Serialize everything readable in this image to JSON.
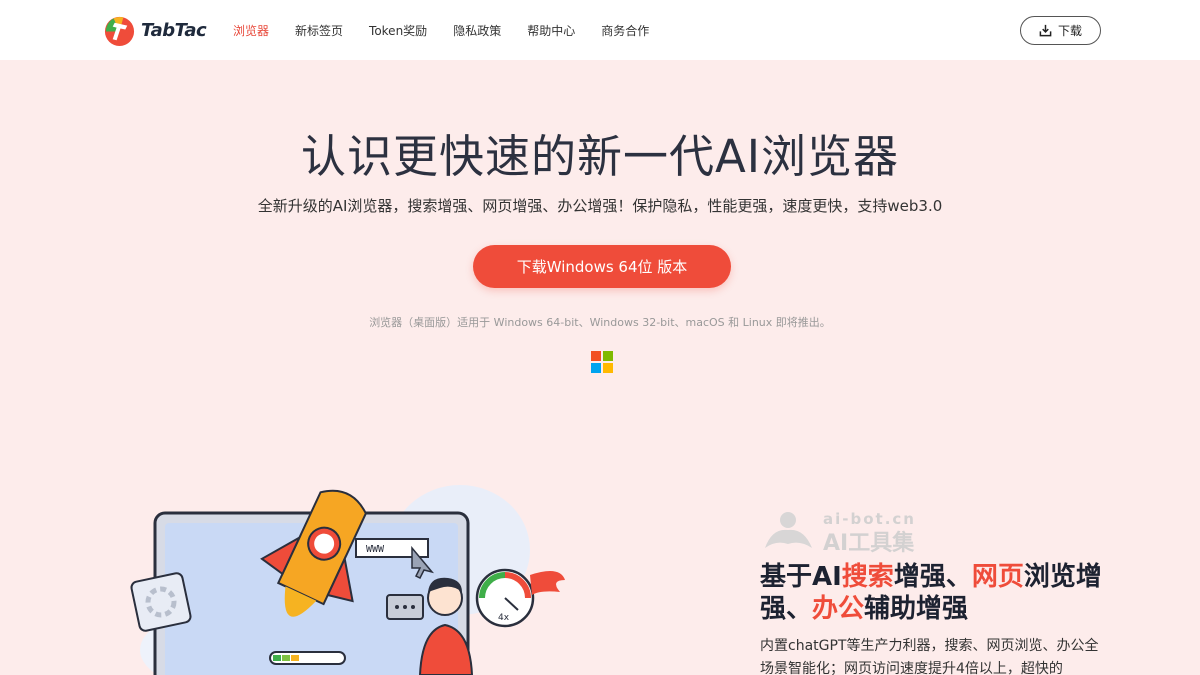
{
  "brand": {
    "name": "TabTac",
    "logo_icon": "tabtac-logo-icon"
  },
  "nav": {
    "items": [
      {
        "label": "浏览器",
        "active": true
      },
      {
        "label": "新标签页",
        "active": false
      },
      {
        "label": "Token奖励",
        "active": false
      },
      {
        "label": "隐私政策",
        "active": false
      },
      {
        "label": "帮助中心",
        "active": false
      },
      {
        "label": "商务合作",
        "active": false
      }
    ],
    "download_label": "下载",
    "download_icon": "download-icon"
  },
  "hero": {
    "title": "认识更快速的新一代AI浏览器",
    "subtitle": "全新升级的AI浏览器，搜索增强、网页增强、办公增强！保护隐私，性能更强，速度更快，支持web3.0",
    "cta_label": "下载Windows 64位 版本",
    "platform_note": "浏览器（桌面版）适用于 Windows 64-bit、Windows 32-bit、macOS 和 Linux 即将推出。",
    "platform_icon": "windows-logo-icon"
  },
  "illustration": {
    "address_text": "WWW",
    "speed_label": "4x"
  },
  "watermark": {
    "line1": "ai-bot.cn",
    "line2": "AI工具集"
  },
  "feature": {
    "title_parts": [
      "基于AI",
      "搜索",
      "增强、",
      "网页",
      "浏览增强、",
      "办公",
      "辅助增强"
    ],
    "description": "内置chatGPT等生产力利器，搜索、网页浏览、办公全场景智能化；网页访问速度提升4倍以上，超快的"
  },
  "colors": {
    "accent": "#ef4c3a",
    "background": "#fdeceb",
    "title": "#2c3140"
  }
}
